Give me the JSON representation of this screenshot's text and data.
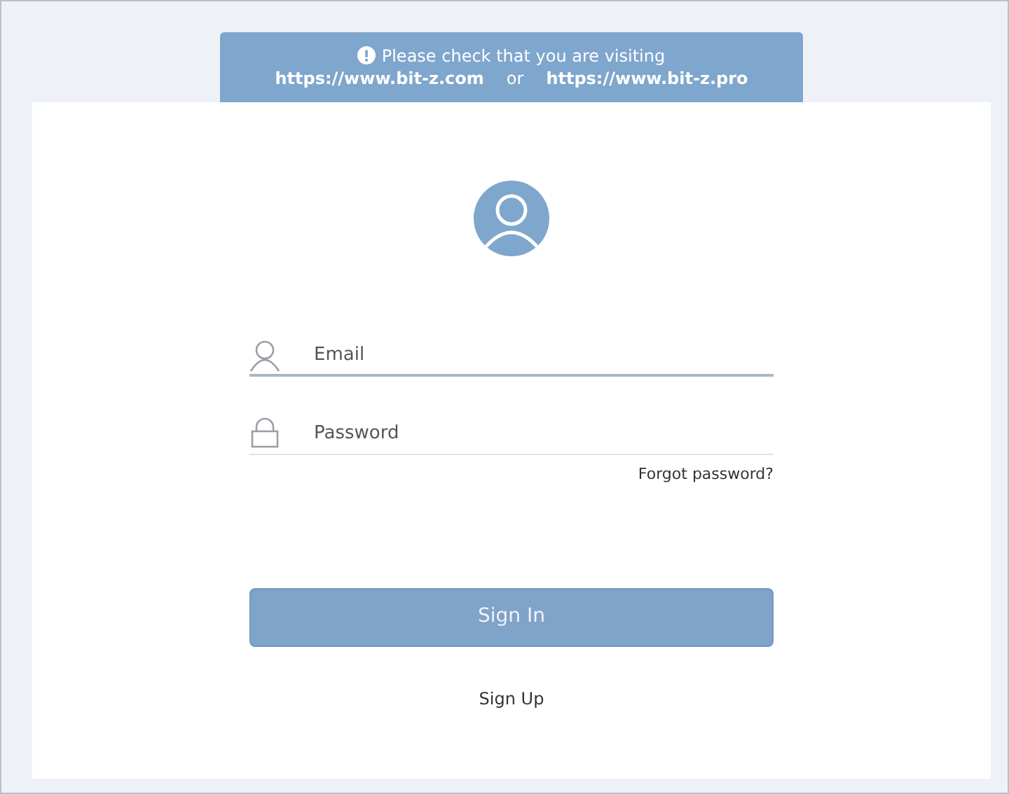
{
  "notice": {
    "message": "Please check that you are visiting",
    "links": [
      "https://www.bit-z.com",
      "https://www.bit-z.pro"
    ],
    "separator": "or"
  },
  "form": {
    "fields": [
      {
        "kind": "email",
        "placeholder": "Email",
        "focused": true
      },
      {
        "kind": "password",
        "placeholder": "Password",
        "focused": false
      }
    ],
    "forgot_link": "Forgot password?",
    "submit": "Sign In",
    "signup_link": "Sign Up"
  }
}
